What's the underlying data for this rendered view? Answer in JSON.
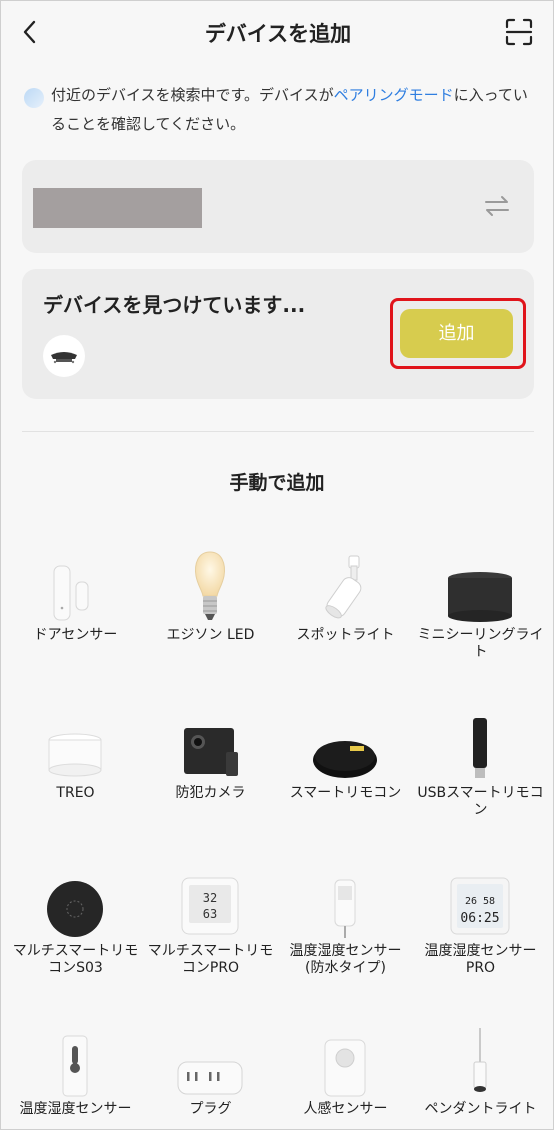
{
  "header": {
    "title": "デバイスを追加",
    "back_icon": "chevron-left-icon",
    "scan_icon": "scan-icon"
  },
  "notice": {
    "text_before": "付近のデバイスを検索中です。デバイスが",
    "link": "ペアリングモード",
    "text_after": "に入っていることを確認してください。",
    "link_color": "#2f7ee0"
  },
  "wifi_card": {
    "switch_icon": "swap-arrows-icon"
  },
  "found": {
    "title": "デバイスを見つけています...",
    "add_label": "追加",
    "highlight_color": "#e0141b",
    "button_color": "#d7cc4e"
  },
  "manual": {
    "title": "手動で追加"
  },
  "devices": [
    {
      "label": "ドアセンサー",
      "icon": "door-sensor-icon"
    },
    {
      "label": "エジソン LED",
      "icon": "edison-bulb-icon"
    },
    {
      "label": "スポットライト",
      "icon": "spotlight-icon"
    },
    {
      "label": "ミニシーリングライト",
      "icon": "ceiling-light-icon"
    },
    {
      "label": "TREO",
      "icon": "treo-light-icon"
    },
    {
      "label": "防犯カメラ",
      "icon": "security-camera-icon"
    },
    {
      "label": "スマートリモコン",
      "icon": "smart-remote-icon"
    },
    {
      "label": "USBスマートリモコン",
      "icon": "usb-remote-icon"
    },
    {
      "label": "マルチスマートリモコンS03",
      "icon": "multi-remote-s03-icon"
    },
    {
      "label": "マルチスマートリモコンPRO",
      "icon": "multi-remote-pro-icon"
    },
    {
      "label": "温度湿度センサー(防水タイプ)",
      "icon": "waterproof-thermometer-icon"
    },
    {
      "label": "温度湿度センサーPRO",
      "icon": "thermometer-pro-icon"
    },
    {
      "label": "温度湿度センサー",
      "icon": "thermometer-icon"
    },
    {
      "label": "プラグ",
      "icon": "plug-icon"
    },
    {
      "label": "人感センサー",
      "icon": "motion-sensor-icon"
    },
    {
      "label": "ペンダントライト",
      "icon": "pendant-light-icon"
    }
  ]
}
